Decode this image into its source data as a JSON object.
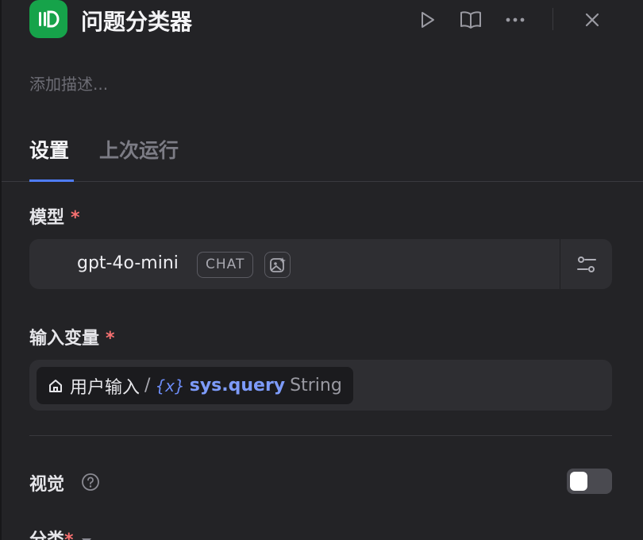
{
  "header": {
    "title": "问题分类器",
    "app_icon": "classifier-icon",
    "accent": "#16a34a"
  },
  "description": {
    "placeholder": "添加描述..."
  },
  "tabs": [
    {
      "label": "设置",
      "active": true
    },
    {
      "label": "上次运行",
      "active": false
    }
  ],
  "model": {
    "label": "模型",
    "required_mark": "*",
    "name": "gpt-4o-mini",
    "mode_badge": "CHAT"
  },
  "input_variable": {
    "label": "输入变量",
    "required_mark": "*",
    "source": "用户输入",
    "separator": "/",
    "var_glyph": "{x}",
    "var_name": "sys.query",
    "var_type": "String"
  },
  "vision": {
    "label": "视觉",
    "enabled": false
  },
  "classes": {
    "label": "分类",
    "required_mark": "*"
  },
  "colors": {
    "tab_accent": "#4f7cf7",
    "variable_blue": "#7d9bfa",
    "required_red": "#f87171"
  }
}
